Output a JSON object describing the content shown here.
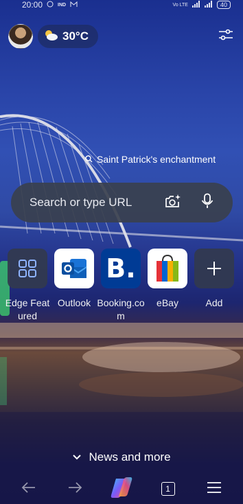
{
  "status_bar": {
    "time": "20:00",
    "left_icons": [
      "whatsapp-icon",
      "ind-icon",
      "gmail-icon"
    ],
    "right_icons": [
      "volte-icon",
      "signal-icon",
      "signal-icon"
    ],
    "battery": "40"
  },
  "weather": {
    "temperature": "30°C",
    "icon": "partly-cloudy-icon"
  },
  "background_caption": "Saint Patrick's enchantment",
  "search": {
    "placeholder": "Search or type URL"
  },
  "tiles": [
    {
      "label": "Edge Featured",
      "icon": "edge-featured-icon"
    },
    {
      "label": "Outlook",
      "icon": "outlook-icon"
    },
    {
      "label": "Booking.com",
      "icon": "booking-icon"
    },
    {
      "label": "eBay",
      "icon": "ebay-icon"
    },
    {
      "label": "Add",
      "icon": "add-icon"
    }
  ],
  "news_label": "News and more",
  "bottom_nav": {
    "tab_count": "1"
  }
}
